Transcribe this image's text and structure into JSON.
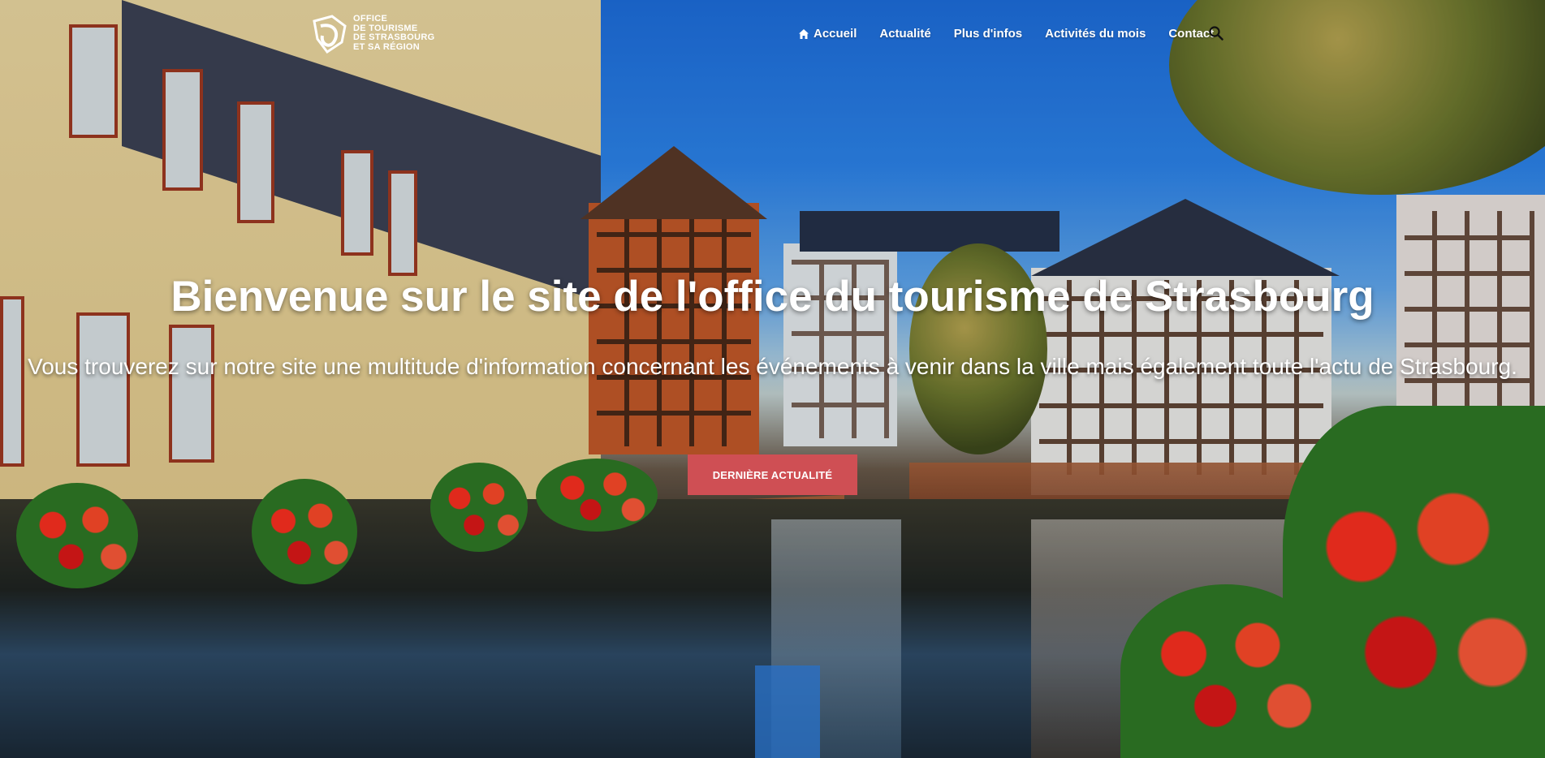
{
  "header": {
    "logo_lines": [
      "Office",
      "de Tourisme",
      "de Strasbourg",
      "et sa région"
    ],
    "logo_icon": "logo-swirl-icon"
  },
  "nav": {
    "items": [
      {
        "label": "Accueil",
        "icon": "home-icon"
      },
      {
        "label": "Actualité"
      },
      {
        "label": "Plus d'infos"
      },
      {
        "label": "Activités du mois"
      },
      {
        "label": "Contact"
      }
    ],
    "search_icon": "search-icon"
  },
  "hero": {
    "title": "Bienvenue sur le site de l'office du tourisme de Strasbourg",
    "subtitle": "Vous trouverez sur notre site une multitude d'information concernant les événements à venir dans la ville mais également toute l'actu de Strasbourg.",
    "cta_label": "Dernière actualité"
  },
  "colors": {
    "accent": "#cf4f54",
    "text": "#ffffff"
  }
}
